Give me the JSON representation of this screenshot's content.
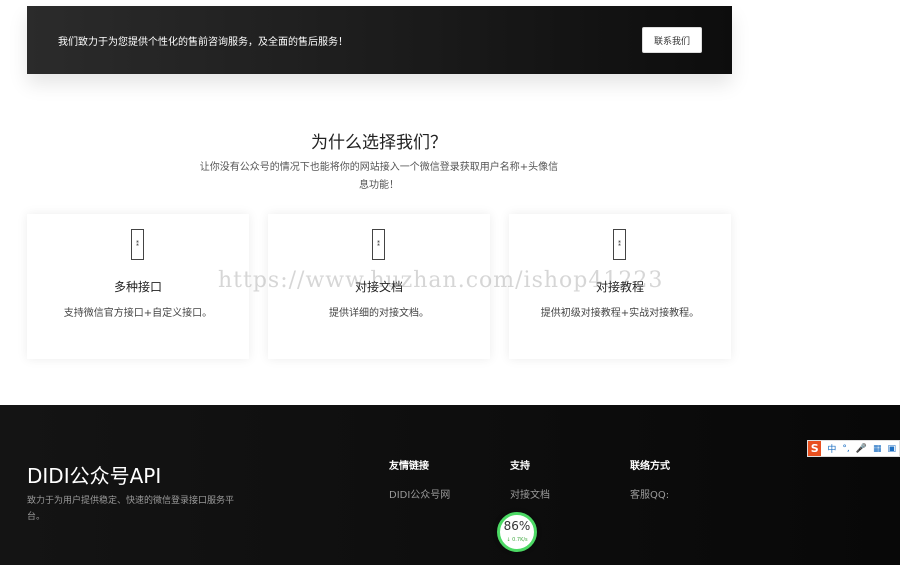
{
  "banner": {
    "text": "我们致力于为您提供个性化的售前咨询服务，及全面的售后服务！",
    "button_label": "联系我们"
  },
  "why": {
    "title": "为什么选择我们？",
    "description": "让你没有公众号的情况下也能将你的网站接入一个微信登录获取用户名称+头像信息功能！"
  },
  "features": [
    {
      "title": "多种接口",
      "description": "支持微信官方接口+自定义接口。"
    },
    {
      "title": "对接文档",
      "description": "提供详细的对接文档。"
    },
    {
      "title": "对接教程",
      "description": "提供初级对接教程+实战对接教程。"
    }
  ],
  "watermark": "https://www.huzhan.com/ishop41223",
  "footer": {
    "brand": "DIDI公众号API",
    "description": "致力于为用户提供稳定、快速的微信登录接口服务平台。",
    "columns": [
      {
        "title": "友情链接",
        "link": "DIDI公众号网"
      },
      {
        "title": "支持",
        "link": "对接文档"
      },
      {
        "title": "联络方式",
        "link": "客服QQ:"
      }
    ]
  },
  "speed_widget": {
    "percent": "86%",
    "rate": "↓ 0.7K/s"
  },
  "ime": {
    "logo": "S",
    "items": [
      "中",
      "°,",
      "🎤",
      "▦",
      "▣"
    ]
  },
  "colors": {
    "accent_green": "#4cd964",
    "ime_orange": "#e8501f"
  }
}
